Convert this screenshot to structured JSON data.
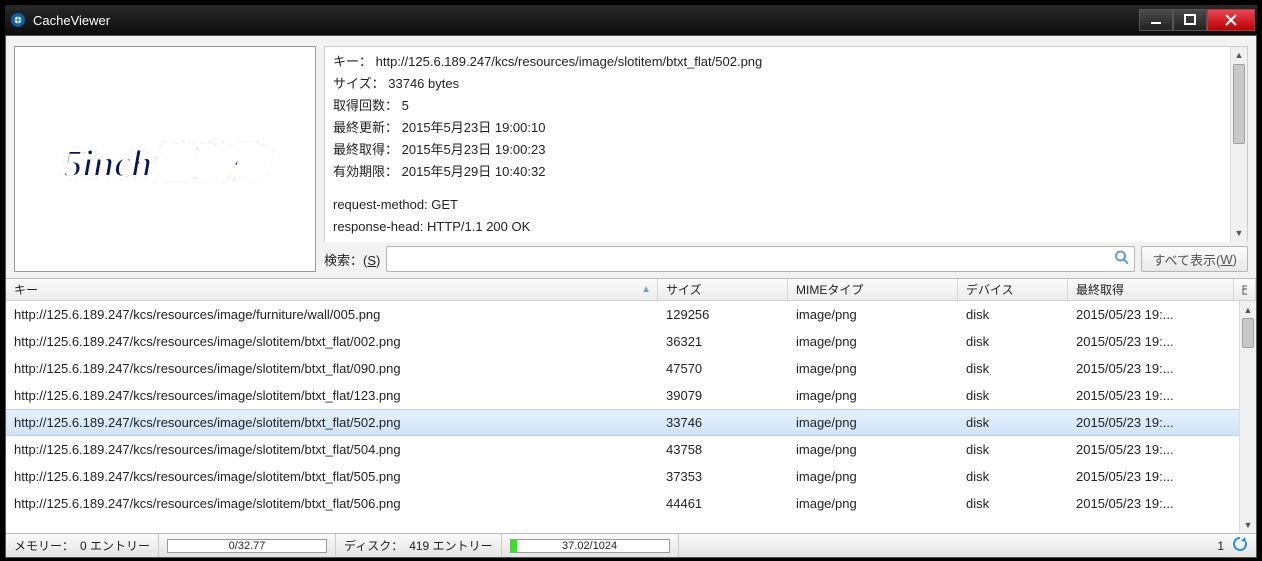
{
  "window": {
    "title": "CacheViewer"
  },
  "preview": {
    "text": "5inch連装砲"
  },
  "details": {
    "key_label": "キー：",
    "key_value": "http://125.6.189.247/kcs/resources/image/slotitem/btxt_flat/502.png",
    "size_label": "サイズ：",
    "size_value": "33746 bytes",
    "fetchcount_label": "取得回数：",
    "fetchcount_value": "5",
    "lastmod_label": "最終更新：",
    "lastmod_value": "2015年5月23日 19:00:10",
    "lastfetch_label": "最終取得：",
    "lastfetch_value": "2015年5月23日 19:00:23",
    "expire_label": "有効期限：",
    "expire_value": "2015年5月29日 10:40:32",
    "reqmethod": "request-method: GET",
    "resphead": "response-head: HTTP/1.1 200 OK"
  },
  "search": {
    "label_prefix": "検索：(",
    "mnemonic": "S",
    "label_suffix": ")",
    "placeholder": "",
    "showall_prefix": "すべて表示(",
    "showall_mnemonic": "W",
    "showall_suffix": ")"
  },
  "columns": {
    "key": "キー",
    "size": "サイズ",
    "mime": "MIMEタイプ",
    "device": "デバイス",
    "last": "最終取得"
  },
  "rows": [
    {
      "key": "http://125.6.189.247/kcs/resources/image/furniture/wall/005.png",
      "size": "129256",
      "mime": "image/png",
      "dev": "disk",
      "last": "2015/05/23 19:..."
    },
    {
      "key": "http://125.6.189.247/kcs/resources/image/slotitem/btxt_flat/002.png",
      "size": "36321",
      "mime": "image/png",
      "dev": "disk",
      "last": "2015/05/23 19:..."
    },
    {
      "key": "http://125.6.189.247/kcs/resources/image/slotitem/btxt_flat/090.png",
      "size": "47570",
      "mime": "image/png",
      "dev": "disk",
      "last": "2015/05/23 19:..."
    },
    {
      "key": "http://125.6.189.247/kcs/resources/image/slotitem/btxt_flat/123.png",
      "size": "39079",
      "mime": "image/png",
      "dev": "disk",
      "last": "2015/05/23 19:..."
    },
    {
      "key": "http://125.6.189.247/kcs/resources/image/slotitem/btxt_flat/502.png",
      "size": "33746",
      "mime": "image/png",
      "dev": "disk",
      "last": "2015/05/23 19:...",
      "selected": true
    },
    {
      "key": "http://125.6.189.247/kcs/resources/image/slotitem/btxt_flat/504.png",
      "size": "43758",
      "mime": "image/png",
      "dev": "disk",
      "last": "2015/05/23 19:..."
    },
    {
      "key": "http://125.6.189.247/kcs/resources/image/slotitem/btxt_flat/505.png",
      "size": "37353",
      "mime": "image/png",
      "dev": "disk",
      "last": "2015/05/23 19:..."
    },
    {
      "key": "http://125.6.189.247/kcs/resources/image/slotitem/btxt_flat/506.png",
      "size": "44461",
      "mime": "image/png",
      "dev": "disk",
      "last": "2015/05/23 19:..."
    }
  ],
  "status": {
    "memory_label": "メモリー：",
    "memory_entries": "0 エントリー",
    "memory_bar": "0/32.77",
    "memory_fill_pct": 0,
    "disk_label": "ディスク：",
    "disk_entries": "419 エントリー",
    "disk_bar": "37.02/1024",
    "disk_fill_pct": 4,
    "one": "1"
  }
}
